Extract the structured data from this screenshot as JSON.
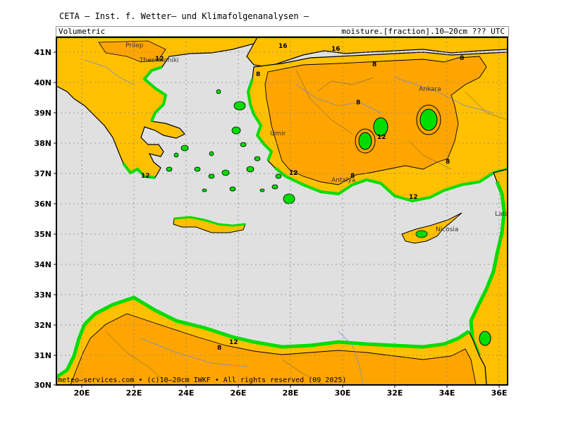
{
  "header": {
    "title": "CETA – Inst. f. Wetter– und Klimafolgenanalysen –",
    "left": "Volumetric",
    "right": "moisture.[fraction].10–20cm ??? UTC"
  },
  "footer": {
    "credit": "meteo–services.com • (c)10–20cm IWKF • All rights reserved (09 2025)"
  },
  "axes": {
    "x_ticks": [
      "20E",
      "22E",
      "24E",
      "26E",
      "28E",
      "30E",
      "32E",
      "34E",
      "36E"
    ],
    "y_ticks": [
      "41N",
      "40N",
      "39N",
      "38N",
      "37N",
      "36N",
      "35N",
      "34N",
      "33N",
      "32N",
      "31N",
      "30N"
    ]
  },
  "places": [
    "Prilep",
    "Thessaloniki",
    "Ankara",
    "Izmir",
    "Antalya",
    "Nicosia",
    "Latakia"
  ],
  "contour_labels": [
    "8",
    "12",
    "16"
  ],
  "colors": {
    "sea": "#e0e0e0",
    "land_dry": "#ffa500",
    "land_mid": "#ffc000",
    "land_wet": "#00dd00",
    "wet_blue": "#2040ff",
    "border": "#000000",
    "rivers": "#6b8cd6",
    "grid": "#888888"
  }
}
